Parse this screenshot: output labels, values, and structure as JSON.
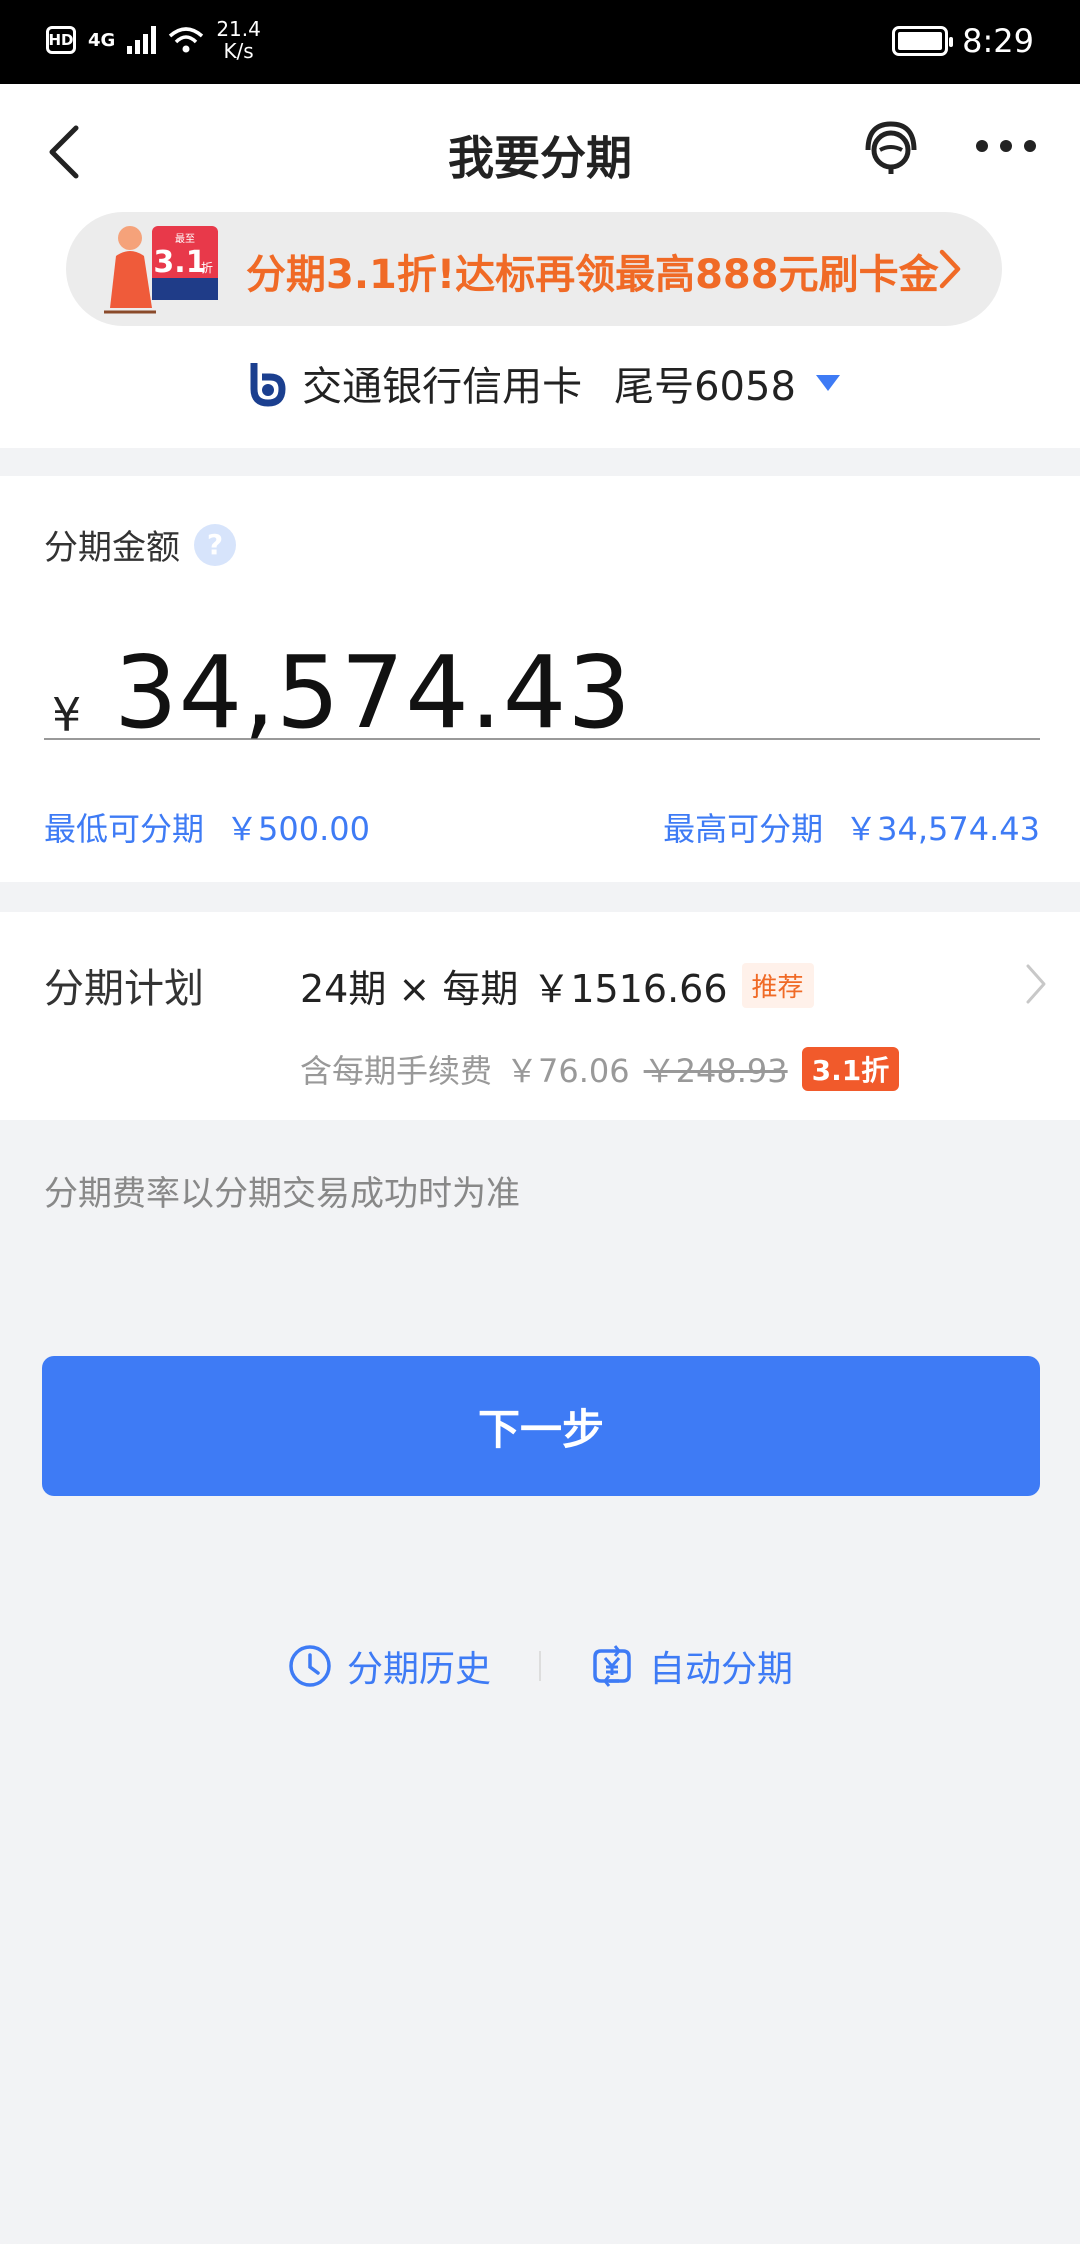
{
  "status_bar": {
    "hd": "HD",
    "network": "4G",
    "speed_value": "21.4",
    "speed_unit": "K/s",
    "time": "8:29"
  },
  "nav": {
    "title": "我要分期"
  },
  "promo": {
    "badge_small": "最至",
    "badge_value": "3.1",
    "badge_unit": "折",
    "text": "分期3.1折!达标再领最高888元刷卡金"
  },
  "card": {
    "bank_name": "交通银行信用卡",
    "tail": "尾号6058"
  },
  "amount": {
    "label": "分期金额",
    "help": "?",
    "currency": "¥",
    "value": "34,574.43",
    "min_label": "最低可分期",
    "min_value": "￥500.00",
    "max_label": "最高可分期",
    "max_value": "￥34,574.43"
  },
  "plan": {
    "label": "分期计划",
    "periods": "24期 × 每期",
    "per_amount": "￥1516.66",
    "recommend": "推荐",
    "fee_label": "含每期手续费",
    "fee_value": "￥76.06",
    "fee_original": "￥248.93",
    "discount": "3.1折"
  },
  "note": "分期费率以分期交易成功时为准",
  "next_button": "下一步",
  "bottom": {
    "history": "分期历史",
    "auto": "自动分期"
  },
  "colors": {
    "primary": "#3e7bf5",
    "promo": "#f06a26",
    "discount": "#f15a2b"
  }
}
